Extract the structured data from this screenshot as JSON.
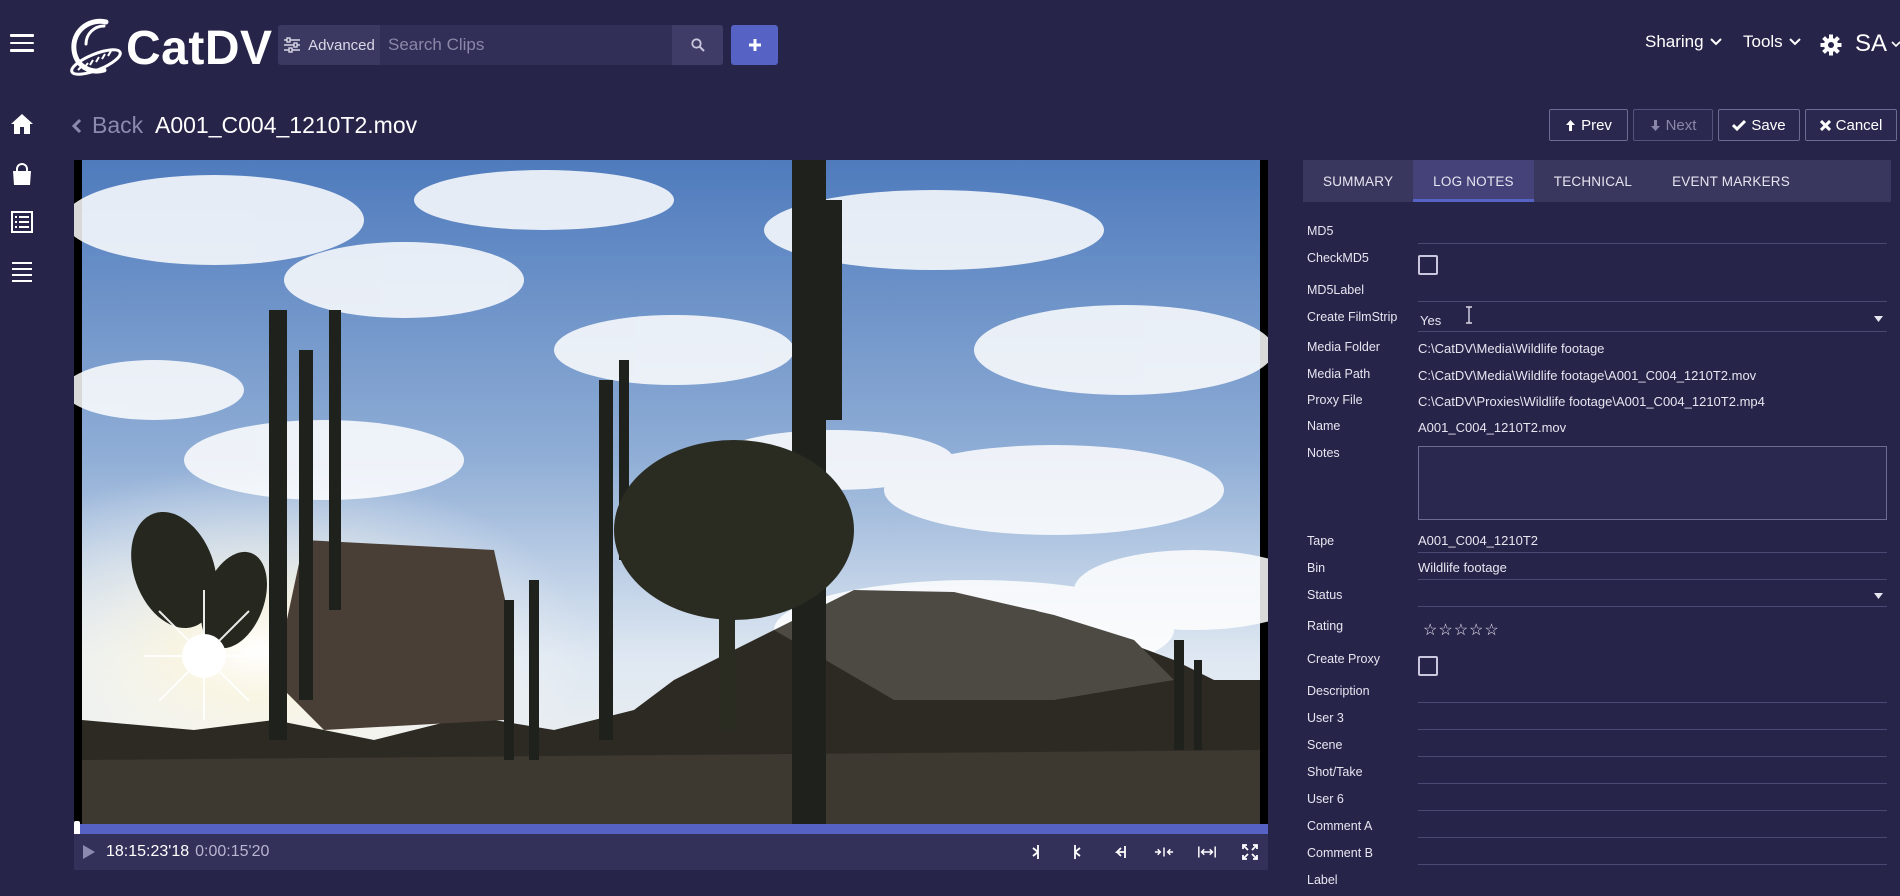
{
  "app": {
    "name": "CatDV"
  },
  "search": {
    "advanced_label": "Advanced",
    "placeholder": "Search Clips"
  },
  "menus": {
    "sharing": "Sharing",
    "tools": "Tools",
    "avatar": "SA"
  },
  "header": {
    "back_label": "Back",
    "title": "A001_C004_1210T2.mov",
    "prev_label": "Prev",
    "next_label": "Next",
    "save_label": "Save",
    "cancel_label": "Cancel"
  },
  "player": {
    "timecode": "18:15:23'18",
    "duration": "0:00:15'20",
    "progress_fraction": 0.0
  },
  "tabs": [
    {
      "label": "SUMMARY"
    },
    {
      "label": "LOG NOTES"
    },
    {
      "label": "TECHNICAL"
    },
    {
      "label": "EVENT MARKERS"
    }
  ],
  "active_tab": "LOG NOTES",
  "fields": {
    "md5": {
      "label": "MD5",
      "value": ""
    },
    "checkmd5": {
      "label": "CheckMD5",
      "checked": false
    },
    "md5label": {
      "label": "MD5Label",
      "value": ""
    },
    "create_filmstrip": {
      "label": "Create FilmStrip",
      "value": "Yes"
    },
    "media_folder": {
      "label": "Media Folder",
      "value": "C:\\CatDV\\Media\\Wildlife footage"
    },
    "media_path": {
      "label": "Media Path",
      "value": "C:\\CatDV\\Media\\Wildlife footage\\A001_C004_1210T2.mov"
    },
    "proxy_file": {
      "label": "Proxy File",
      "value": "C:\\CatDV\\Proxies\\Wildlife footage\\A001_C004_1210T2.mp4"
    },
    "name": {
      "label": "Name",
      "value": "A001_C004_1210T2.mov"
    },
    "notes": {
      "label": "Notes",
      "value": ""
    },
    "tape": {
      "label": "Tape",
      "value": "A001_C004_1210T2"
    },
    "bin": {
      "label": "Bin",
      "value": "Wildlife footage"
    },
    "status": {
      "label": "Status",
      "value": ""
    },
    "rating": {
      "label": "Rating",
      "value": 0,
      "max": 5,
      "stars_text": "☆☆☆☆☆"
    },
    "create_proxy": {
      "label": "Create Proxy",
      "checked": false
    },
    "description": {
      "label": "Description",
      "value": ""
    },
    "user3": {
      "label": "User 3",
      "value": ""
    },
    "scene": {
      "label": "Scene",
      "value": ""
    },
    "shot_take": {
      "label": "Shot/Take",
      "value": ""
    },
    "user6": {
      "label": "User 6",
      "value": ""
    },
    "comment_a": {
      "label": "Comment A",
      "value": ""
    },
    "comment_b": {
      "label": "Comment B",
      "value": ""
    },
    "label": {
      "label": "Label",
      "value": ""
    }
  },
  "colors": {
    "background": "#27244a",
    "accent": "#5663c4",
    "panel": "#3a375f"
  }
}
